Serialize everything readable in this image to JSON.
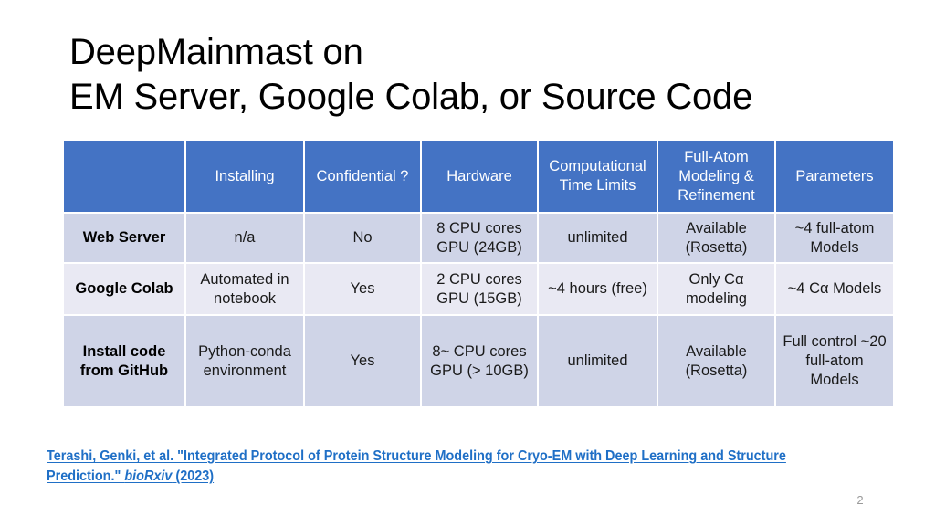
{
  "slide": {
    "title": "DeepMainmast on\nEM Server, Google Colab, or Source Code",
    "page_number": "2"
  },
  "colors": {
    "header_blue": "#4473C4",
    "row_shade": "#CFD4E7",
    "row_light": "#E9E9F3",
    "link_blue": "#1F6FC6",
    "page_number_gray": "#9a9a9a"
  },
  "table": {
    "headers": [
      "",
      "Installing",
      "Confidential ?",
      "Hardware",
      "Computational Time Limits",
      "Full-Atom Modeling & Refinement",
      "Parameters"
    ],
    "rows": [
      {
        "name": "Web Server",
        "installing": "n/a",
        "confidential": "No",
        "hardware": "8 CPU cores GPU (24GB)",
        "time_limits": "unlimited",
        "full_atom": "Available (Rosetta)",
        "parameters": "~4 full-atom Models"
      },
      {
        "name": "Google Colab",
        "installing": "Automated in notebook",
        "confidential": "Yes",
        "hardware": "2 CPU cores GPU (15GB)",
        "time_limits": "~4 hours (free)",
        "full_atom": "Only Cα modeling",
        "parameters": "~4 Cα Models"
      },
      {
        "name": "Install code from GitHub",
        "installing": "Python-conda environment",
        "confidential": "Yes",
        "hardware": "8~ CPU cores GPU (> 10GB)",
        "time_limits": "unlimited",
        "full_atom": "Available (Rosetta)",
        "parameters": "Full control ~20 full-atom Models"
      }
    ]
  },
  "citation": {
    "part1": "Terashi, Genki, et al. \"Integrated Protocol of Protein Structure Modeling for Cryo-EM with Deep Learning and Structure Prediction.\" ",
    "journal": "bioRxiv",
    "part2": " (2023)"
  }
}
